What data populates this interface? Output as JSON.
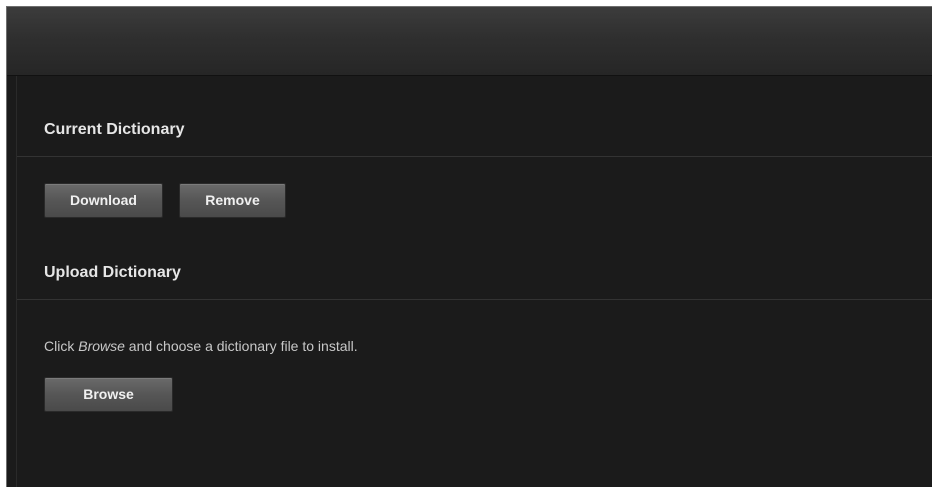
{
  "current_dictionary": {
    "title": "Current Dictionary",
    "download_label": "Download",
    "remove_label": "Remove"
  },
  "upload_dictionary": {
    "title": "Upload Dictionary",
    "instruction_prefix": "Click ",
    "instruction_emphasis": "Browse",
    "instruction_suffix": " and choose a dictionary file to install.",
    "browse_label": "Browse"
  },
  "colors": {
    "background": "#1b1b1b",
    "header": "#2f2f2f",
    "button": "#565656",
    "text": "#e6e6e6"
  }
}
